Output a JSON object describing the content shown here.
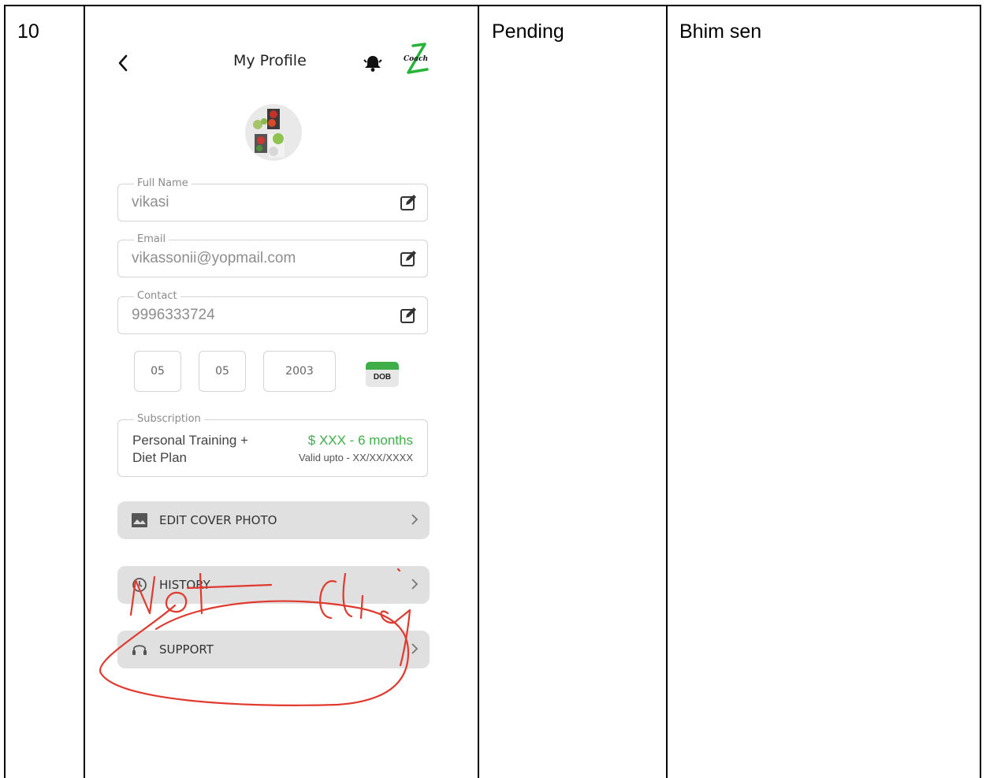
{
  "row": {
    "number": "10",
    "status": "Pending",
    "assignee": "Bhim sen"
  },
  "screen": {
    "title": "My Profile",
    "icons": {
      "back": "chevron-left-icon",
      "notification": "bell-icon",
      "logo": "zcoach-logo"
    },
    "logo_text": "Coach",
    "fields": [
      {
        "label": "Full Name",
        "value": "vikasi"
      },
      {
        "label": "Email",
        "value": "vikassonii@yopmail.com"
      },
      {
        "label": "Contact",
        "value": "9996333724"
      }
    ],
    "dob": {
      "day": "05",
      "month": "05",
      "year": "2003",
      "button_label": "DOB"
    },
    "subscription": {
      "label": "Subscription",
      "plan_line1": "Personal Training +",
      "plan_line2": "Diet Plan",
      "price": "$ XXX - 6 months",
      "valid": "Valid upto - XX/XX/XXXX",
      "price_color": "#3fae49"
    },
    "menu": [
      {
        "label": "EDIT COVER PHOTO",
        "icon": "image-icon"
      },
      {
        "label": "HISTORY",
        "icon": "history-icon"
      },
      {
        "label": "SUPPORT",
        "icon": "headset-icon"
      }
    ]
  },
  "annotation": {
    "text": "Not Cliq",
    "color": "#e03a2f"
  }
}
